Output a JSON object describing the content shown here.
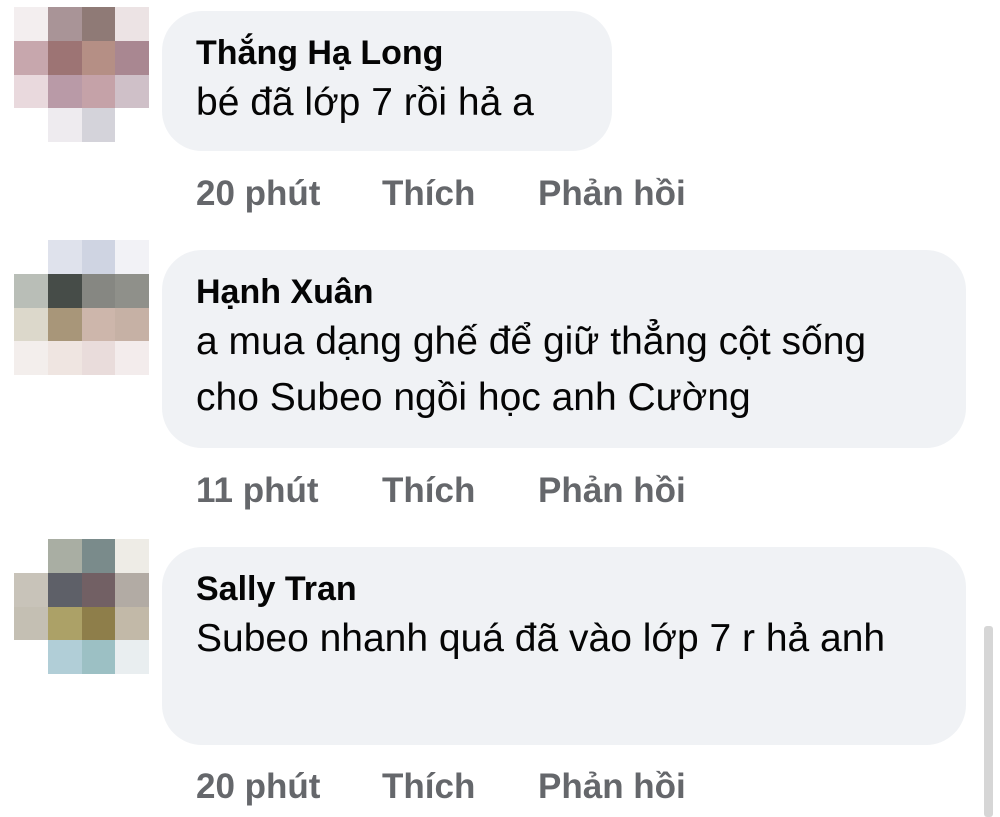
{
  "comments": [
    {
      "author": "Thắng Hạ Long",
      "text": "bé đã lớp 7 rồi hả a",
      "time": "20 phút",
      "like": "Thích",
      "reply": "Phản hồi",
      "avatar_colors": [
        "#f3eeef",
        "#a99497",
        "#8f7a76",
        "#ece3e4",
        "#c7a7ad",
        "#9d7474",
        "#b58f85",
        "#a98791",
        "#e9d9dd",
        "#b99aa7",
        "#c5a2a8",
        "#cfc0c8",
        "#ffffff",
        "#eeebef",
        "#d4d3da",
        "#ffffff"
      ]
    },
    {
      "author": "Hạnh Xuân",
      "text": "a mua dạng ghế để giữ thẳng cột sống cho Subeo ngồi học anh Cường",
      "time": "11 phút",
      "like": "Thích",
      "reply": "Phản hồi",
      "avatar_colors": [
        "#ffffff",
        "#dfe2ec",
        "#cfd4e2",
        "#f2f2f6",
        "#b9beb7",
        "#464c48",
        "#868782",
        "#8f908a",
        "#dcd8cb",
        "#a89679",
        "#cdb6ab",
        "#c6b1a5",
        "#f3eeec",
        "#efe5e1",
        "#e9dcdb",
        "#f3ecec"
      ]
    },
    {
      "author": "Sally Tran",
      "text": "Subeo nhanh quá đã vào lớp 7 r hả anh",
      "time": "20 phút",
      "like": "Thích",
      "reply": "Phản hồi",
      "avatar_colors": [
        "#ffffff",
        "#a9aea3",
        "#7a8b8b",
        "#eeece6",
        "#c8c3b9",
        "#5e6068",
        "#726064",
        "#b2aba4",
        "#c4bfb3",
        "#aca167",
        "#8e7e4a",
        "#c2b9a8",
        "#ffffff",
        "#b1ced7",
        "#9cc0c4",
        "#e9eef0"
      ]
    }
  ]
}
